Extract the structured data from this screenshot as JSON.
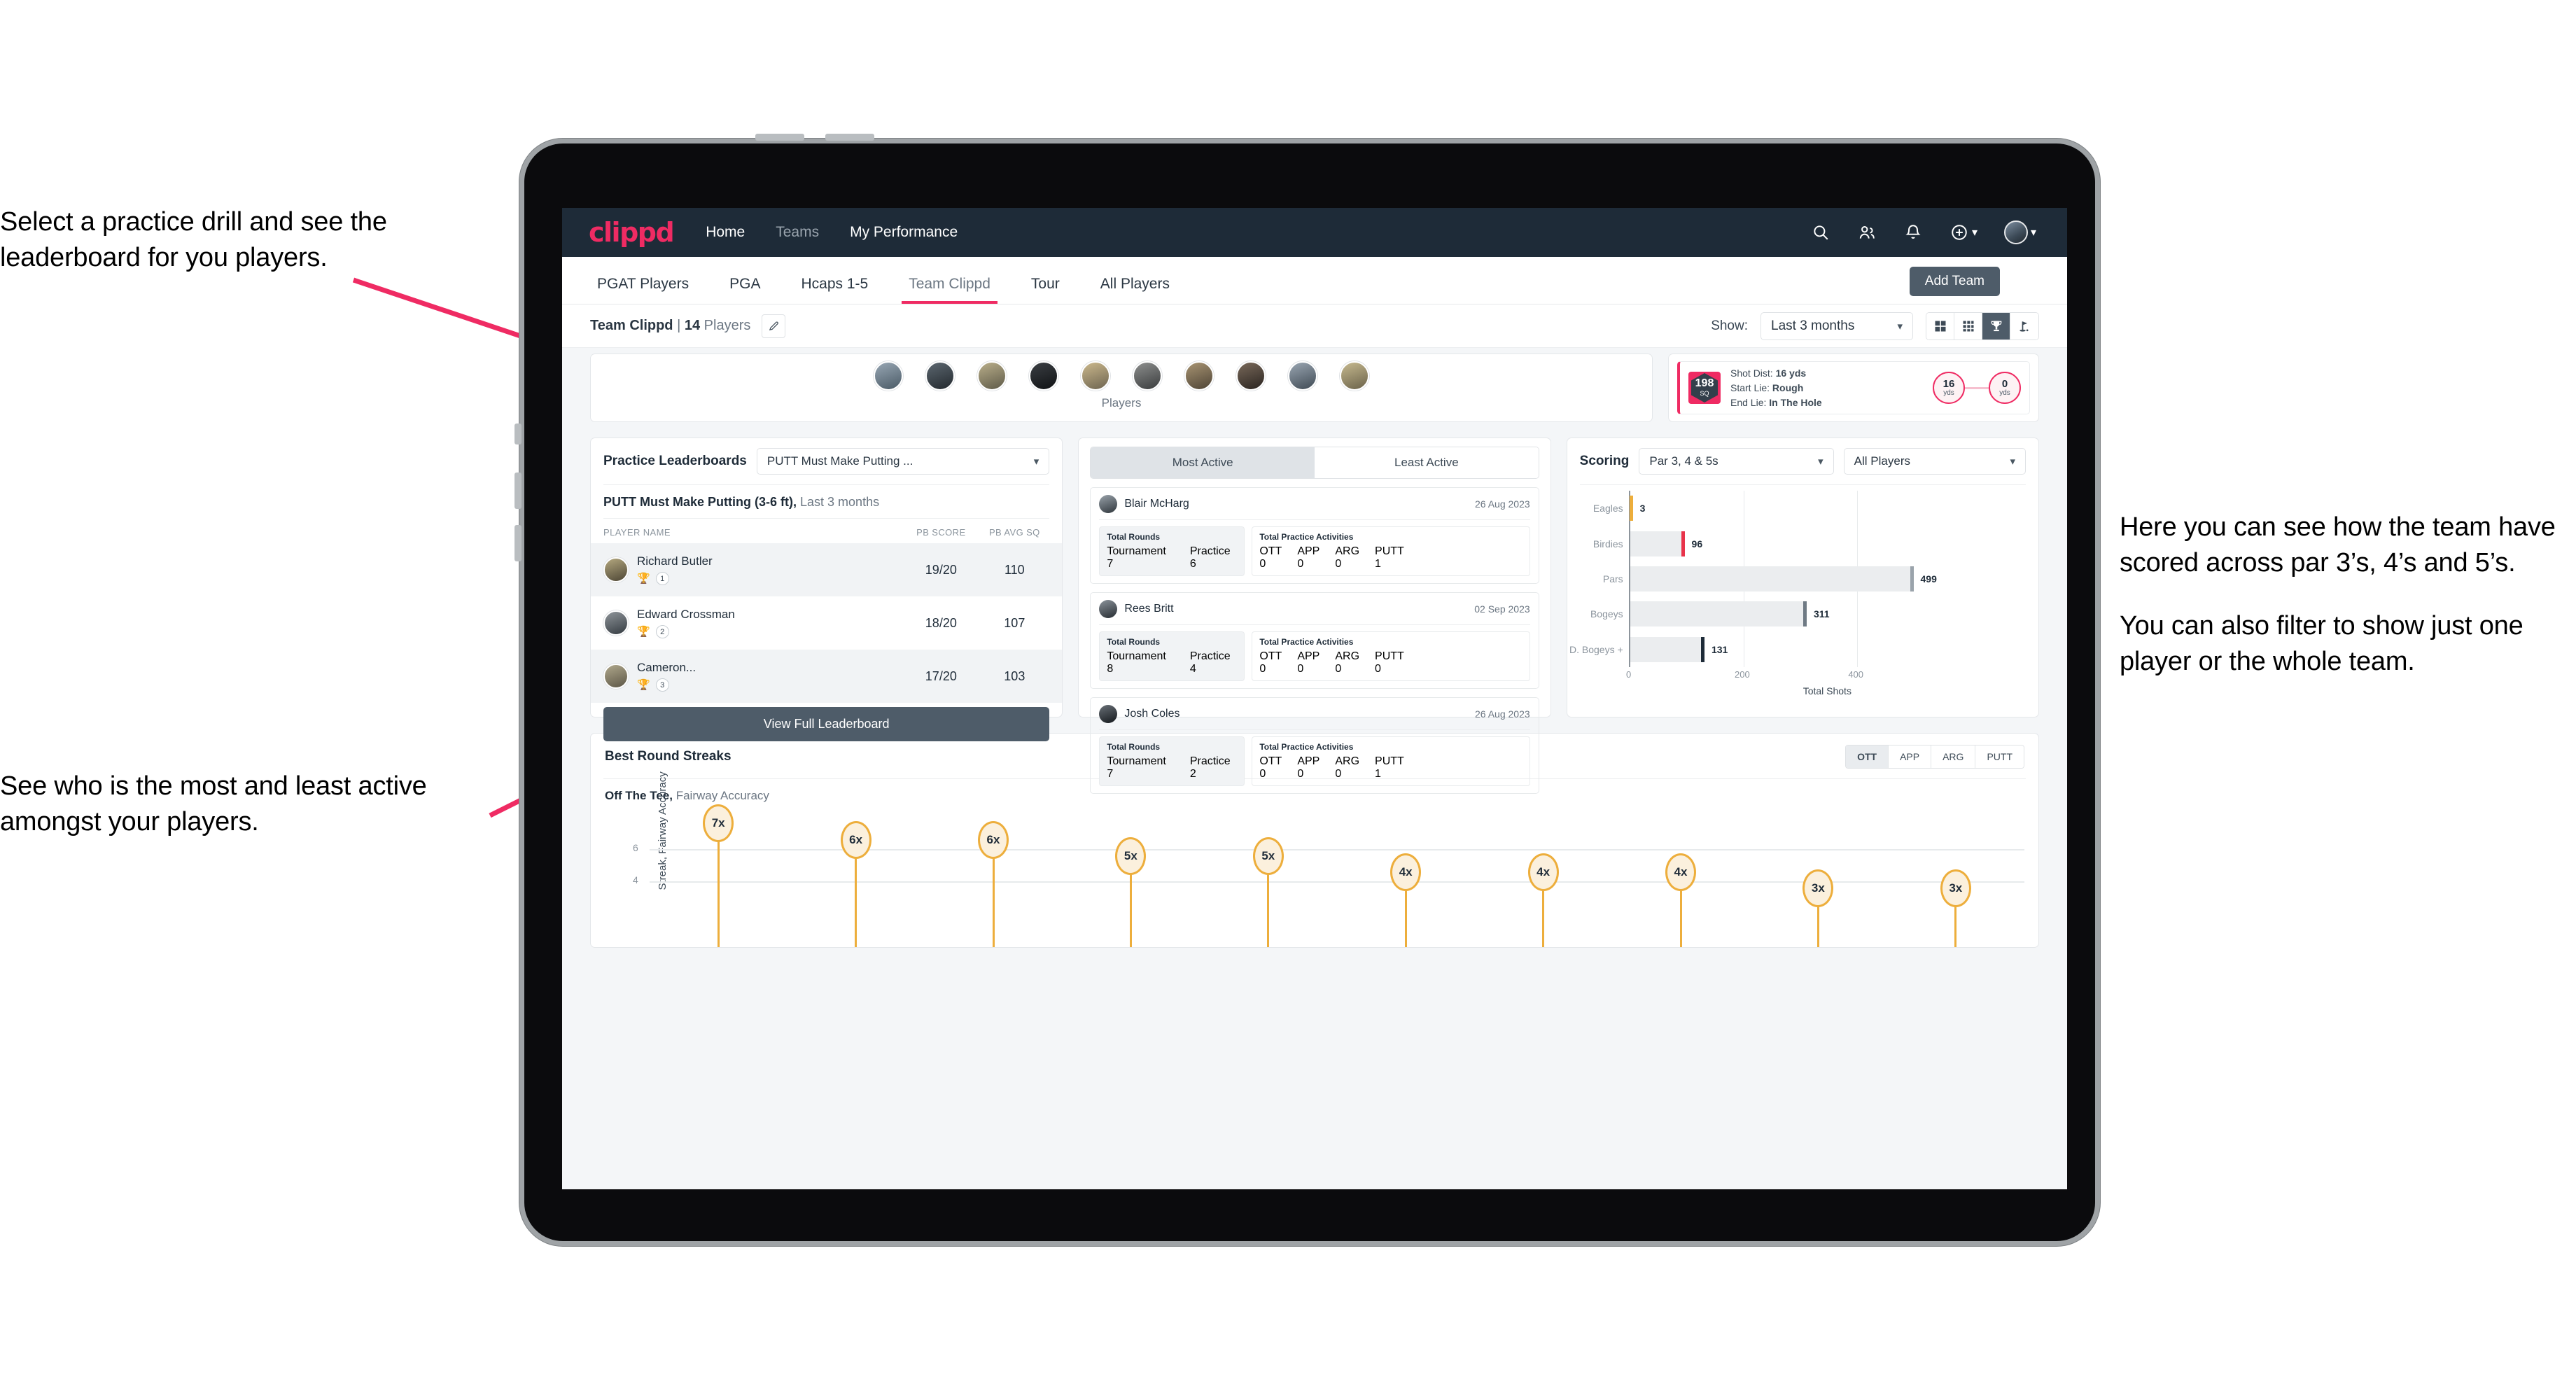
{
  "annotations": {
    "left_top": "Select a practice drill and see the leaderboard for you players.",
    "left_bottom": "See who is the most and least active amongst your players.",
    "right_1": "Here you can see how the team have scored across par 3’s, 4’s and 5’s.",
    "right_2": "You can also filter to show just one player or the whole team."
  },
  "app": {
    "brand": "clippd",
    "brand_color": "#ef2b63",
    "nav_links": [
      {
        "label": "Home",
        "dim": false
      },
      {
        "label": "Teams",
        "dim": true
      },
      {
        "label": "My Performance",
        "dim": false
      }
    ],
    "nav_icons": [
      "search-icon",
      "people-icon",
      "bell-icon",
      "plus-circle-icon",
      "avatar"
    ],
    "tabs": [
      {
        "label": "PGAT Players",
        "active": false
      },
      {
        "label": "PGA",
        "active": false
      },
      {
        "label": "Hcaps 1-5",
        "active": false
      },
      {
        "label": "Team Clippd",
        "active": true
      },
      {
        "label": "Tour",
        "active": false
      },
      {
        "label": "All Players",
        "active": false
      }
    ],
    "add_team_label": "Add Team"
  },
  "subheader": {
    "team_name": "Team Clippd",
    "separator": "|",
    "player_count": "14",
    "players_word": "Players",
    "edit_icon": "pencil-icon",
    "show_label": "Show:",
    "range_value": "Last 3 months",
    "view_toggle": [
      {
        "icon": "grid-large-icon",
        "active": false
      },
      {
        "icon": "grid-small-icon",
        "active": false
      },
      {
        "icon": "trophy-icon",
        "active": true
      },
      {
        "icon": "golf-flag-icon",
        "active": false
      }
    ]
  },
  "players_strip": {
    "caption": "Players",
    "avatar_count": 10
  },
  "shot_card": {
    "sq_value": "198",
    "sq_unit": "SQ",
    "lines": [
      {
        "label": "Shot Dist:",
        "value": "16 yds"
      },
      {
        "label": "Start Lie:",
        "value": "Rough"
      },
      {
        "label": "End Lie:",
        "value": "In The Hole"
      }
    ],
    "start_dist": "16",
    "start_unit": "yds",
    "end_dist": "0",
    "end_unit": "yds"
  },
  "leaderboard": {
    "title": "Practice Leaderboards",
    "drill_select": "PUTT Must Make Putting ...",
    "drill_heading": "PUTT Must Make Putting (3-6 ft),",
    "drill_range": "Last 3 months",
    "columns": [
      "PLAYER NAME",
      "PB SCORE",
      "PB AVG SQ"
    ],
    "rows": [
      {
        "name": "Richard Butler",
        "rank": "1",
        "trophy": "gold",
        "pb_score": "19/20",
        "pb_avg_sq": "110"
      },
      {
        "name": "Edward Crossman",
        "rank": "2",
        "trophy": "silver",
        "pb_score": "18/20",
        "pb_avg_sq": "107"
      },
      {
        "name": "Cameron...",
        "rank": "3",
        "trophy": "bronze",
        "pb_score": "17/20",
        "pb_avg_sq": "103"
      }
    ],
    "view_full_label": "View Full Leaderboard"
  },
  "activity": {
    "tabs": [
      {
        "label": "Most Active",
        "active": true
      },
      {
        "label": "Least Active",
        "active": false
      }
    ],
    "rounds_title": "Total Rounds",
    "rounds_keys": [
      "Tournament",
      "Practice"
    ],
    "practice_title": "Total Practice Activities",
    "practice_keys": [
      "OTT",
      "APP",
      "ARG",
      "PUTT"
    ],
    "cards": [
      {
        "name": "Blair McHarg",
        "date": "26 Aug 2023",
        "tournament": "7",
        "practice": "6",
        "ott": "0",
        "app": "0",
        "arg": "0",
        "putt": "1"
      },
      {
        "name": "Rees Britt",
        "date": "02 Sep 2023",
        "tournament": "8",
        "practice": "4",
        "ott": "0",
        "app": "0",
        "arg": "0",
        "putt": "0"
      },
      {
        "name": "Josh Coles",
        "date": "26 Aug 2023",
        "tournament": "7",
        "practice": "2",
        "ott": "0",
        "app": "0",
        "arg": "0",
        "putt": "1"
      }
    ]
  },
  "scoring": {
    "title": "Scoring",
    "par_select": "Par 3, 4 & 5s",
    "player_select": "All Players"
  },
  "streaks": {
    "title": "Best Round Streaks",
    "toggle": [
      {
        "label": "OTT",
        "active": true
      },
      {
        "label": "APP",
        "active": false
      },
      {
        "label": "ARG",
        "active": false
      },
      {
        "label": "PUTT",
        "active": false
      }
    ],
    "subtitle_bold": "Off The Tee,",
    "subtitle_rest": "Fairway Accuracy"
  },
  "chart_data": [
    {
      "type": "bar",
      "id": "scoring-bar-chart",
      "orientation": "horizontal",
      "title": "Scoring",
      "categories": [
        "Eagles",
        "Birdies",
        "Pars",
        "Bogeys",
        "D. Bogeys +"
      ],
      "values": [
        3,
        96,
        499,
        311,
        131
      ],
      "cap_colors": [
        "#edae3c",
        "#e8334a",
        "#9aa3ab",
        "#6f7a84",
        "#1e2b38"
      ],
      "xlabel": "Total Shots",
      "ylabel": "",
      "xlim": [
        0,
        530
      ],
      "xticks": [
        0,
        200,
        400
      ],
      "grid": true,
      "legend": false,
      "bar_color": "#ebedef"
    },
    {
      "type": "bar",
      "id": "best-round-streaks-chart",
      "orientation": "vertical",
      "title": "Best Round Streaks",
      "subtitle": "Off The Tee, Fairway Accuracy",
      "categories": [
        "",
        "",
        "",
        "",
        "",
        "",
        "",
        "",
        "",
        ""
      ],
      "values": [
        7,
        6,
        6,
        5,
        5,
        4,
        4,
        4,
        3,
        3
      ],
      "labels": [
        "7x",
        "6x",
        "6x",
        "5x",
        "5x",
        "4x",
        "4x",
        "4x",
        "3x",
        "3x"
      ],
      "ylabel": "Streak, Fairway Accuracy",
      "xlabel": "",
      "ylim": [
        0,
        7.8
      ],
      "yticks": [
        4,
        6
      ],
      "grid": true,
      "legend": false,
      "marker_fill": "#fbf0dd",
      "marker_stroke": "#edae3c"
    }
  ]
}
